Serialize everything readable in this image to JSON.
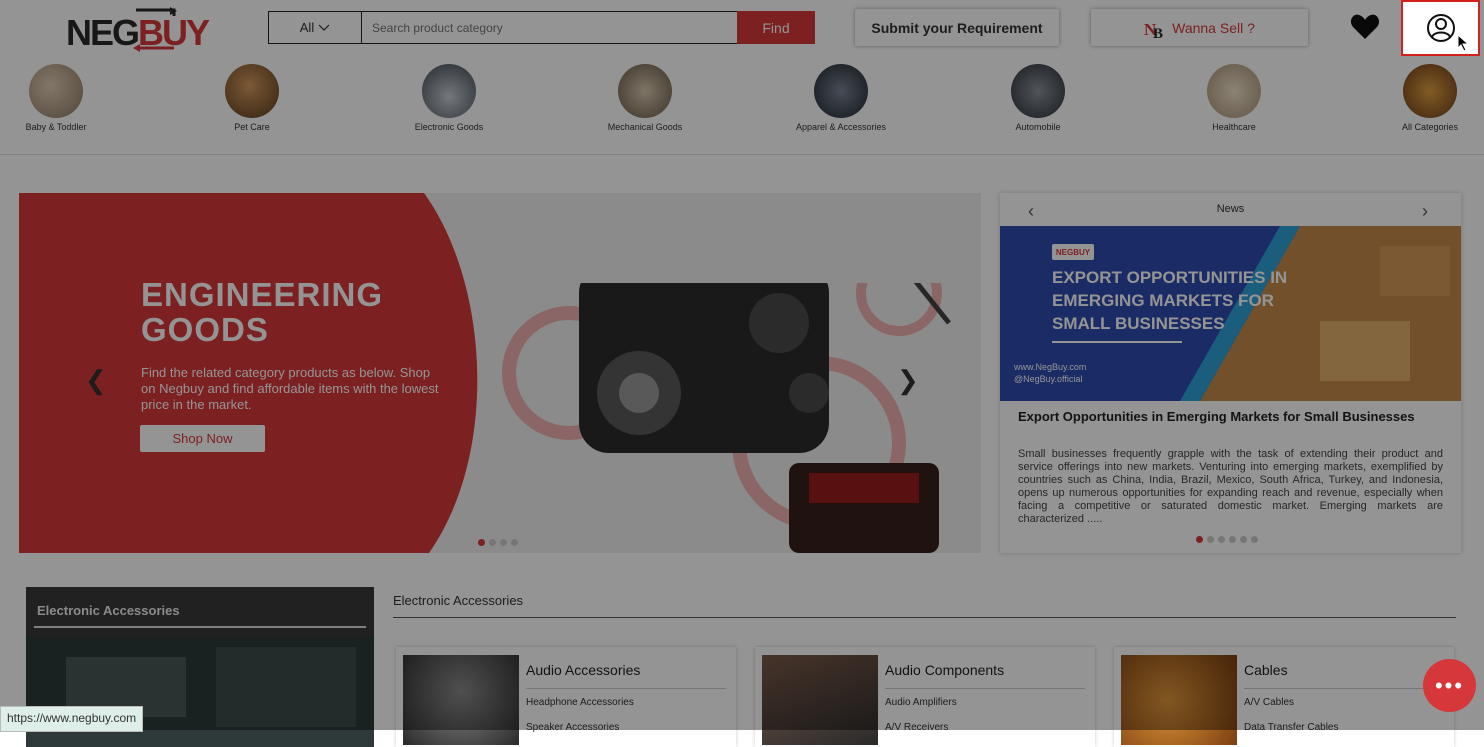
{
  "header": {
    "logo_text_neg": "NEG",
    "logo_text_buy": "BUY",
    "search": {
      "category_selected": "All",
      "placeholder": "Search product category",
      "find_label": "Find"
    },
    "submit_requirement_label": "Submit your Requirement",
    "wanna_sell_label": "Wanna Sell ?",
    "brand_color": "#d6373b"
  },
  "categories": [
    {
      "label": "Baby & Toddler",
      "color": "#b9a38a"
    },
    {
      "label": "Pet Care",
      "color": "#a67a4a"
    },
    {
      "label": "Electronic Goods",
      "color": "#7b8a9a"
    },
    {
      "label": "Mechanical Goods",
      "color": "#9b8d7a"
    },
    {
      "label": "Apparel & Accessories",
      "color": "#55606e"
    },
    {
      "label": "Automobile",
      "color": "#5a5f68"
    },
    {
      "label": "Healthcare",
      "color": "#cbb79e"
    },
    {
      "label": "All Categories",
      "color": "#9a6a3a"
    }
  ],
  "hero": {
    "title_line1": "ENGINEERING",
    "title_line2": "GOODS",
    "description": "Find the related category products as below. Shop on Negbuy and find affordable items with the lowest price in the market.",
    "cta_label": "Shop Now",
    "active_slide": 1,
    "slide_count": 4
  },
  "news": {
    "heading": "News",
    "banner_logo": "NEGBUY",
    "banner_title": "EXPORT OPPORTUNITIES IN EMERGING MARKETS FOR SMALL BUSINESSES",
    "banner_website": "www.NegBuy.com",
    "banner_handle": "@NegBuy.official",
    "article_title": "Export Opportunities in Emerging Markets for Small Businesses",
    "article_excerpt": "Small businesses frequently grapple with the task of extending their product and service offerings into new markets. Venturing into emerging markets, exemplified by countries such as China, India, Brazil, Mexico, South Africa, Turkey, and Indonesia, opens up numerous opportunities for expanding reach and revenue, especially when facing a competitive or saturated domestic market. Emerging markets are characterized .....",
    "active_slide": 1,
    "slide_count": 6
  },
  "section": {
    "side_title": "Electronic Accessories",
    "title": "Electronic Accessories",
    "cards": [
      {
        "title": "Audio Accessories",
        "item1": "Headphone Accessories",
        "item2": "Speaker Accessories",
        "color": "#4a4a4a"
      },
      {
        "title": "Audio Components",
        "item1": "Audio Amplifiers",
        "item2": "A/V Receivers",
        "color": "#6a4a3a"
      },
      {
        "title": "Cables",
        "item1": "A/V Cables",
        "item2": "Data Transfer Cables",
        "color": "#b46a2a"
      }
    ]
  },
  "status_bar": {
    "url": "https://www.negbuy.com"
  },
  "chat_button": {
    "label": "•••"
  }
}
